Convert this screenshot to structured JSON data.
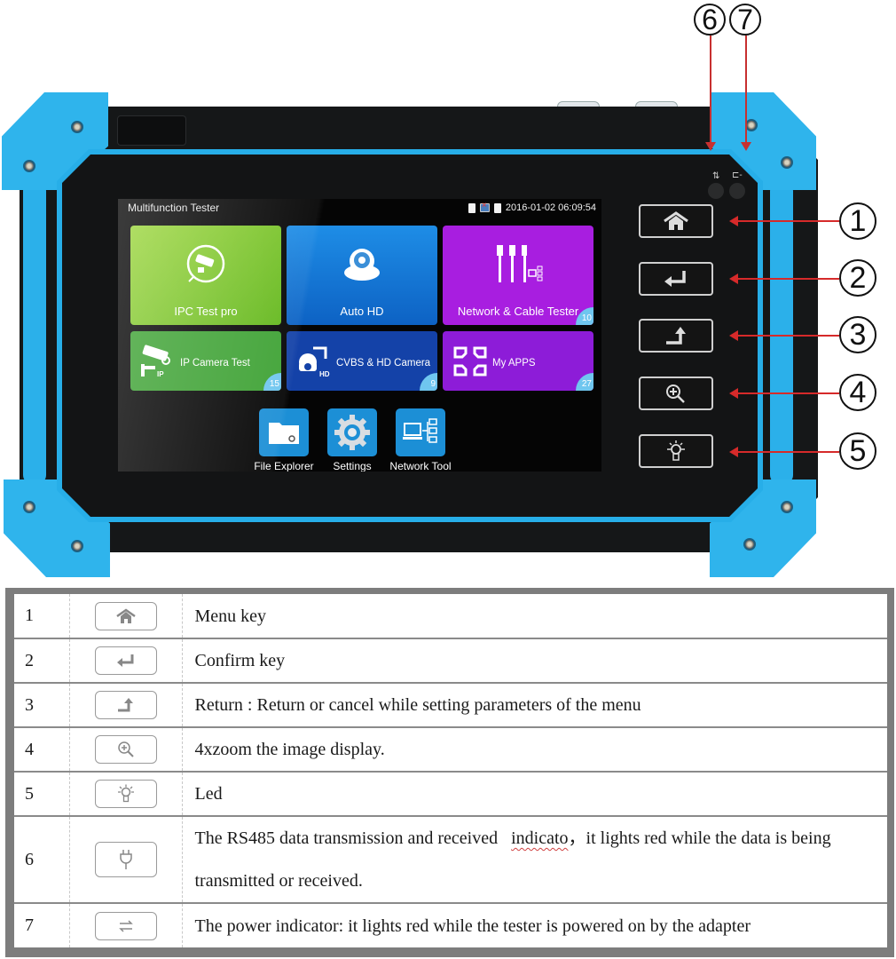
{
  "device": {
    "screen": {
      "app_title": "Multifunction Tester",
      "status": {
        "datetime": "2016-01-02 06:09:54",
        "icons": [
          "sd-card-icon",
          "network-disconnected-icon",
          "battery-icon"
        ]
      },
      "tiles": [
        {
          "label": "IPC Test pro",
          "icon": "ip-camera-test-icon",
          "badge": null,
          "color": "#7cc52a"
        },
        {
          "label": "Auto HD",
          "icon": "dome-camera-icon",
          "badge": null,
          "color": "#1478d6"
        },
        {
          "label": "Network & Cable Tester",
          "icon": "network-cable-icon",
          "badge": "10",
          "color": "#a81ee0"
        },
        {
          "label": "IP Camera Test",
          "icon": "ip-camera-icon",
          "badge": "15",
          "color": "#3ea234"
        },
        {
          "label": "CVBS & HD Camera",
          "icon": "ptz-camera-icon",
          "badge": "9",
          "color": "#1442a8"
        },
        {
          "label": "My APPS",
          "icon": "apps-icon",
          "badge": "27",
          "color": "#8d1cd8"
        }
      ],
      "dock": [
        {
          "label": "File Explorer",
          "icon": "folder-icon"
        },
        {
          "label": "Settings",
          "icon": "gear-icon"
        },
        {
          "label": "Network Tool",
          "icon": "network-tool-icon"
        }
      ]
    },
    "indicator_labels": {
      "rs485": "⇅",
      "power": "⊏-"
    },
    "callouts": [
      "1",
      "2",
      "3",
      "4",
      "5",
      "6",
      "7"
    ]
  },
  "key_table": {
    "rows": [
      {
        "num": "1",
        "icon": "home-icon",
        "desc": "Menu key"
      },
      {
        "num": "2",
        "icon": "enter-icon",
        "desc": "Confirm key"
      },
      {
        "num": "3",
        "icon": "return-icon",
        "desc": "Return : Return or cancel while setting parameters of the menu"
      },
      {
        "num": "4",
        "icon": "zoom-in-icon",
        "desc": "4xzoom the image display."
      },
      {
        "num": "5",
        "icon": "light-bulb-icon",
        "desc": "Led"
      },
      {
        "num": "6",
        "icon": "plug-icon",
        "desc_part1": "The RS485 data transmission and received",
        "desc_flag": "indicato",
        "desc_part2": "，it lights red while the data is being transmitted or received."
      },
      {
        "num": "7",
        "icon": "transfer-arrows-icon",
        "desc": "The power indicator: it lights red while the tester is powered on by the adapter"
      }
    ]
  }
}
